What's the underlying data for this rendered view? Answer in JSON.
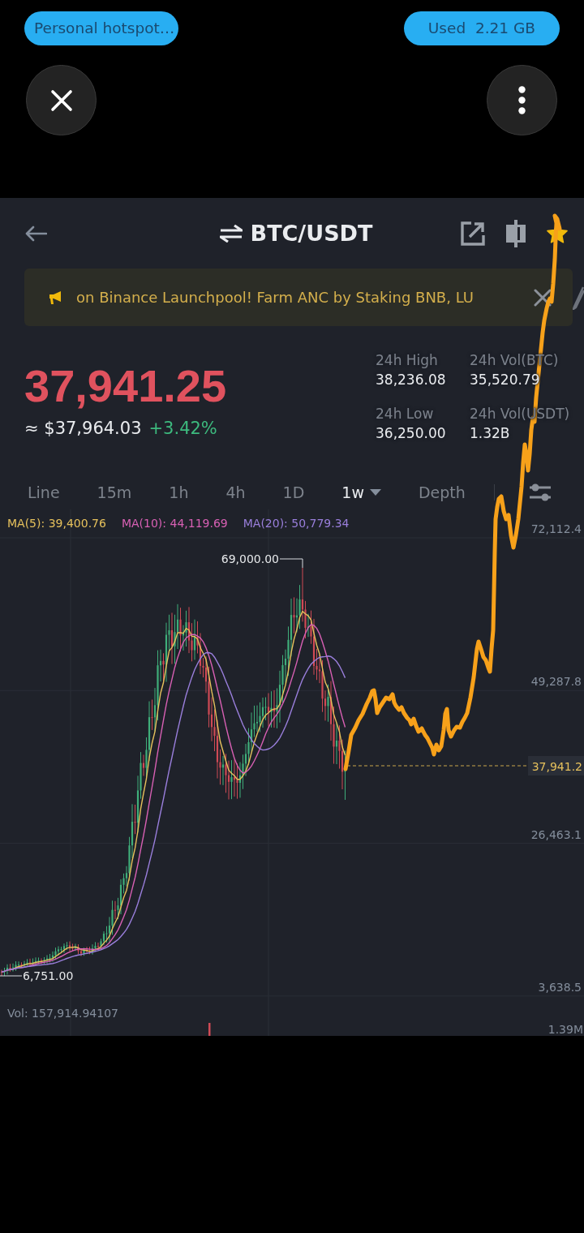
{
  "system_bar": {
    "hotspot": "Personal hotspot…",
    "data_usage": "Used  2.21 GB"
  },
  "header": {
    "title": "BTC/USDT",
    "favorite": true
  },
  "banner": {
    "text": "on Binance Launchpool! Farm ANC by Staking BNB, LU"
  },
  "ticker": {
    "price": "37,941.25",
    "price_rising": false,
    "fiat_price": "≈ $37,964.03",
    "change": "+3.42%",
    "change_rising": true,
    "stats": [
      {
        "label": "24h High",
        "value": "38,236.08"
      },
      {
        "label": "24h Vol(BTC)",
        "value": "35,520.79"
      },
      {
        "label": "24h Low",
        "value": "36,250.00"
      },
      {
        "label": "24h Vol(USDT)",
        "value": "1.32B"
      }
    ]
  },
  "intervals": [
    {
      "label": "Line",
      "kind": "option",
      "selected": false
    },
    {
      "label": "15m",
      "kind": "option",
      "selected": false
    },
    {
      "label": "1h",
      "kind": "option",
      "selected": false
    },
    {
      "label": "4h",
      "kind": "option",
      "selected": false
    },
    {
      "label": "1D",
      "kind": "option",
      "selected": false
    },
    {
      "label": "1w",
      "kind": "dropdown",
      "selected": true
    },
    {
      "label": "Depth",
      "kind": "option",
      "selected": false
    }
  ],
  "chart": {
    "ma_legend": [
      {
        "label": "MA(5): 39,400.76",
        "color": "#e6c15c"
      },
      {
        "label": "MA(10): 44,119.69",
        "color": "#d860b4"
      },
      {
        "label": "MA(20): 50,779.34",
        "color": "#9a7fdc"
      }
    ],
    "price_axis": [
      "72,112.4",
      "49,287.8",
      "26,463.1",
      "3,638.5"
    ],
    "high_marker": "69,000.00",
    "low_marker": "6,751.00",
    "last_price": "37,941.2",
    "volume_label": "Vol: 157,914.94107",
    "volume_axis": "1.39M"
  }
}
